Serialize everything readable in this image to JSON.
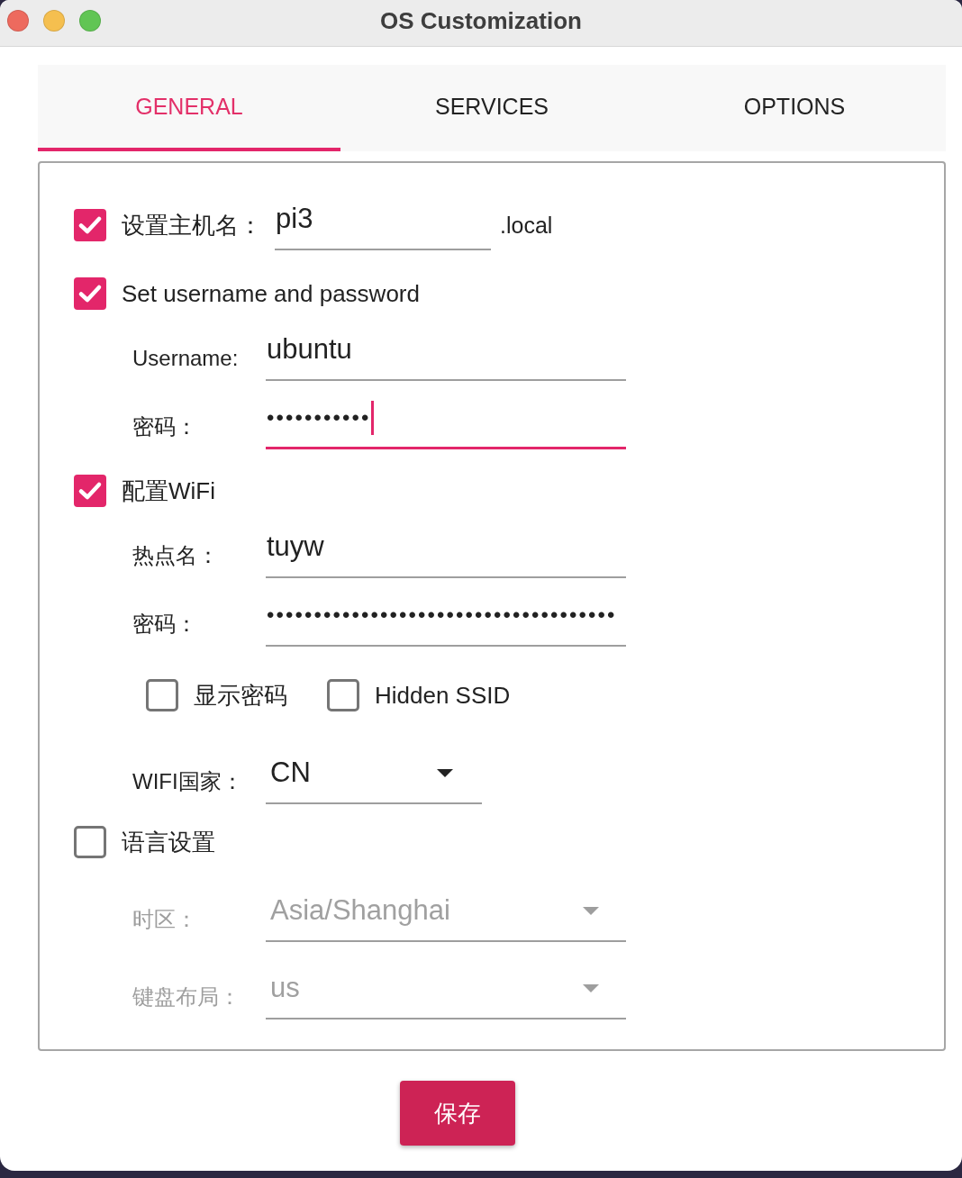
{
  "window": {
    "title": "OS Customization"
  },
  "tabs": [
    {
      "label": "GENERAL",
      "selected": true
    },
    {
      "label": "SERVICES",
      "selected": false
    },
    {
      "label": "OPTIONS",
      "selected": false
    }
  ],
  "hostname": {
    "label": "设置主机名：",
    "checked": true,
    "value": "pi3",
    "suffix": ".local"
  },
  "user": {
    "label": "Set username and password",
    "checked": true,
    "fields": [
      {
        "kind": "text",
        "label": "Username:",
        "value": "ubuntu",
        "focused": false
      },
      {
        "kind": "password",
        "label": "密码：",
        "value": "•••••••••••",
        "focused": true
      }
    ]
  },
  "wifi": {
    "label": "配置WiFi",
    "checked": true,
    "fields": [
      {
        "kind": "text",
        "label": "热点名：",
        "value": "tuyw",
        "focused": false
      },
      {
        "kind": "password",
        "label": "密码：",
        "value": "•••••••••••••••••••••••••••••••••••••",
        "focused": false
      }
    ],
    "options": [
      {
        "label": "显示密码",
        "checked": false
      },
      {
        "label": "Hidden SSID",
        "checked": false
      }
    ],
    "country": {
      "label": "WIFI国家：",
      "value": "CN"
    }
  },
  "locale": {
    "label": "语言设置",
    "checked": false,
    "fields": [
      {
        "label": "时区：",
        "value": "Asia/Shanghai"
      },
      {
        "label": "键盘布局：",
        "value": "us"
      }
    ]
  },
  "save_button": {
    "label": "保存"
  }
}
